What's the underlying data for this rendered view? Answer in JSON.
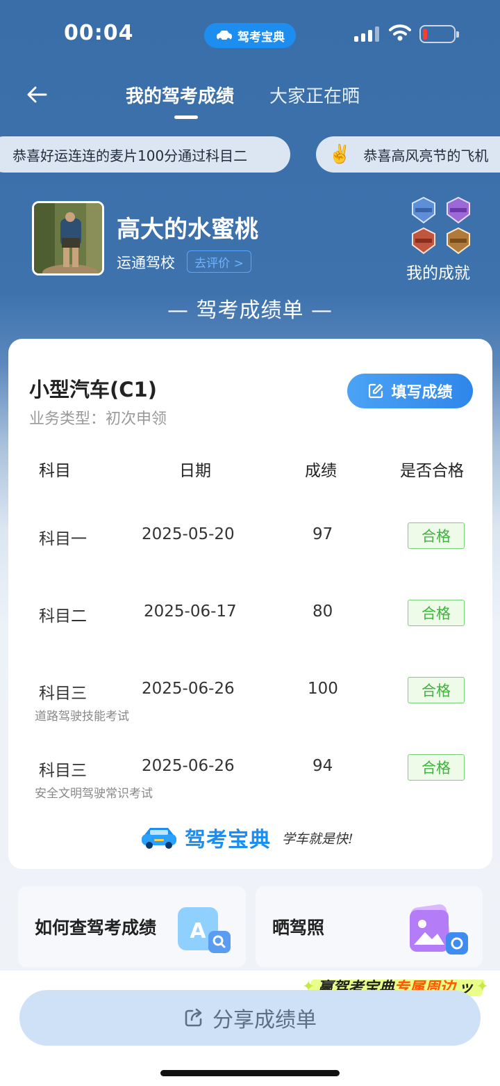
{
  "status_bar": {
    "time": "00:04",
    "app_pill_label": "驾考宝典"
  },
  "nav": {
    "tabs": [
      {
        "label": "我的驾考成绩",
        "active": true
      },
      {
        "label": "大家正在晒",
        "active": false
      }
    ]
  },
  "ticker": [
    {
      "text": "恭喜好运连连的麦片100分通过科目二"
    },
    {
      "text": "恭喜高风亮节的飞机"
    }
  ],
  "profile": {
    "username": "高大的水蜜桃",
    "school": "运通驾校",
    "review_label": "去评价 >",
    "achievements_label": "我的成就"
  },
  "sheet_title": "— 驾考成绩单 —",
  "card": {
    "vehicle": "小型汽车(C1)",
    "business_type": "业务类型：初次申领",
    "fill_button": "填写成绩",
    "headers": {
      "subject": "科目",
      "date": "日期",
      "score": "成绩",
      "pass": "是否合格"
    },
    "rows": [
      {
        "subject": "科目一",
        "date": "2025-05-20",
        "score": "97",
        "result": "合格",
        "note": ""
      },
      {
        "subject": "科目二",
        "date": "2025-06-17",
        "score": "80",
        "result": "合格",
        "note": ""
      },
      {
        "subject": "科目三",
        "date": "2025-06-26",
        "score": "100",
        "result": "合格",
        "note": "道路驾驶技能考试"
      },
      {
        "subject": "科目三",
        "date": "2025-06-26",
        "score": "94",
        "result": "合格",
        "note": "安全文明驾驶常识考试"
      }
    ],
    "brand_name": "驾考宝典",
    "brand_slogan": "学车就是快!"
  },
  "quick_links": [
    {
      "label": "如何查驾考成绩",
      "icon": "search-document-icon"
    },
    {
      "label": "晒驾照",
      "icon": "photo-camera-icon"
    }
  ],
  "promo": {
    "prefix": "赢驾考宝典",
    "highlight": "专属周边"
  },
  "share_button": "分享成绩单",
  "colors": {
    "header_blue": "#3a6ea8",
    "brand_blue": "#1e8df0",
    "pass_green": "#3eb43e"
  }
}
